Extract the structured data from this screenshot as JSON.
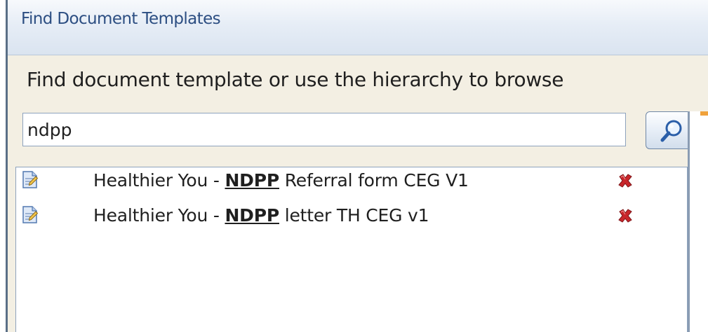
{
  "window": {
    "title": "Find Document Templates"
  },
  "finder": {
    "instruction": "Find document template or use the hierarchy to browse",
    "search_value": "ndpp",
    "search_placeholder": ""
  },
  "results": [
    {
      "prefix": "Healthier You - ",
      "highlight": "NDPP",
      "suffix": " Referral form CEG V1",
      "icon": "document-template-icon",
      "action_icon": "delete-icon"
    },
    {
      "prefix": "Healthier You - ",
      "highlight": "NDPP",
      "suffix": " letter TH CEG v1",
      "icon": "document-template-icon",
      "action_icon": "delete-icon"
    }
  ],
  "colors": {
    "title_text": "#2c4e82",
    "panel_background": "#f3efe3",
    "delete_red": "#c8262b",
    "accent_orange": "#f0a23c"
  }
}
